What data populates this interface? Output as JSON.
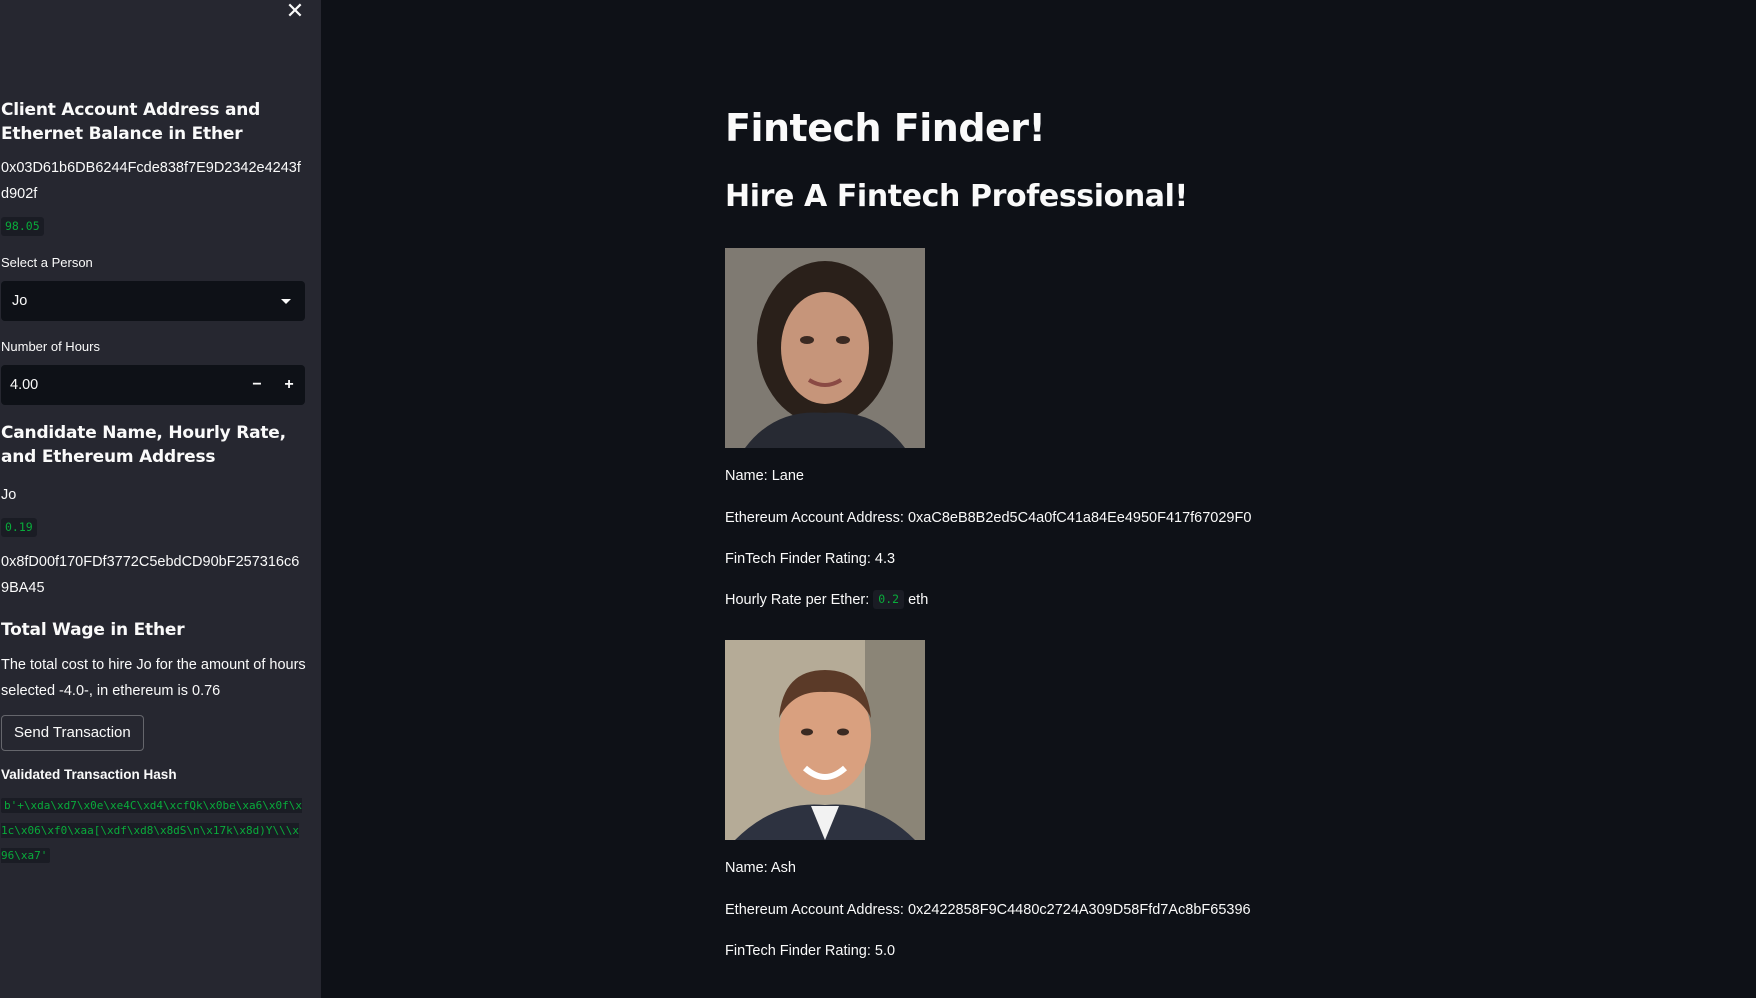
{
  "sidebar": {
    "client_heading": "Client Account Address and Ethernet Balance in Ether",
    "client_address": "0x03D61b6DB6244Fcde838f7E9D2342e4243fd902f",
    "client_balance": "98.05",
    "select_label": "Select a Person",
    "select_value": "Jo",
    "hours_label": "Number of Hours",
    "hours_value": "4.00",
    "stepper_minus": "−",
    "stepper_plus": "+",
    "candidate_heading": "Candidate Name, Hourly Rate, and Ethereum Address",
    "candidate_name": "Jo",
    "candidate_rate": "0.19",
    "candidate_address": "0x8fD00f170FDf3772C5ebdCD90bF257316c69BA45",
    "wage_heading": "Total Wage in Ether",
    "wage_text": "The total cost to hire Jo for the amount of hours selected -4.0-, in ethereum is 0.76",
    "send_button": "Send Transaction",
    "hash_heading": "Validated Transaction Hash",
    "hash_value": "b'+\\xda\\xd7\\x0e\\xe4C\\xd4\\xcfQk\\x0be\\xa6\\x0f\\x1c\\x06\\xf0\\xaa[\\xdf\\xd8\\x8dS\\n\\x17k\\x8d)Y\\\\\\x96\\xa7'"
  },
  "main": {
    "title": "Fintech Finder!",
    "subtitle": "Hire A Fintech Professional!",
    "candidates": [
      {
        "name": "Name: Lane",
        "address": "Ethereum Account Address: 0xaC8eB8B2ed5C4a0fC41a84Ee4950F417f67029F0",
        "rating": "FinTech Finder Rating: 4.3",
        "rate_prefix": "Hourly Rate per Ether:",
        "rate_value": "0.2",
        "rate_suffix": "eth"
      },
      {
        "name": "Name: Ash",
        "address": "Ethereum Account Address: 0x2422858F9C4480c2724A309D58Ffd7Ac8bF65396",
        "rating": "FinTech Finder Rating: 5.0"
      }
    ]
  },
  "colors": {
    "background": "#0e1117",
    "sidebar": "#262730",
    "code_green": "#09ab3b"
  },
  "icons": {
    "close": "close-icon",
    "dropdown": "chevron-down-icon"
  }
}
